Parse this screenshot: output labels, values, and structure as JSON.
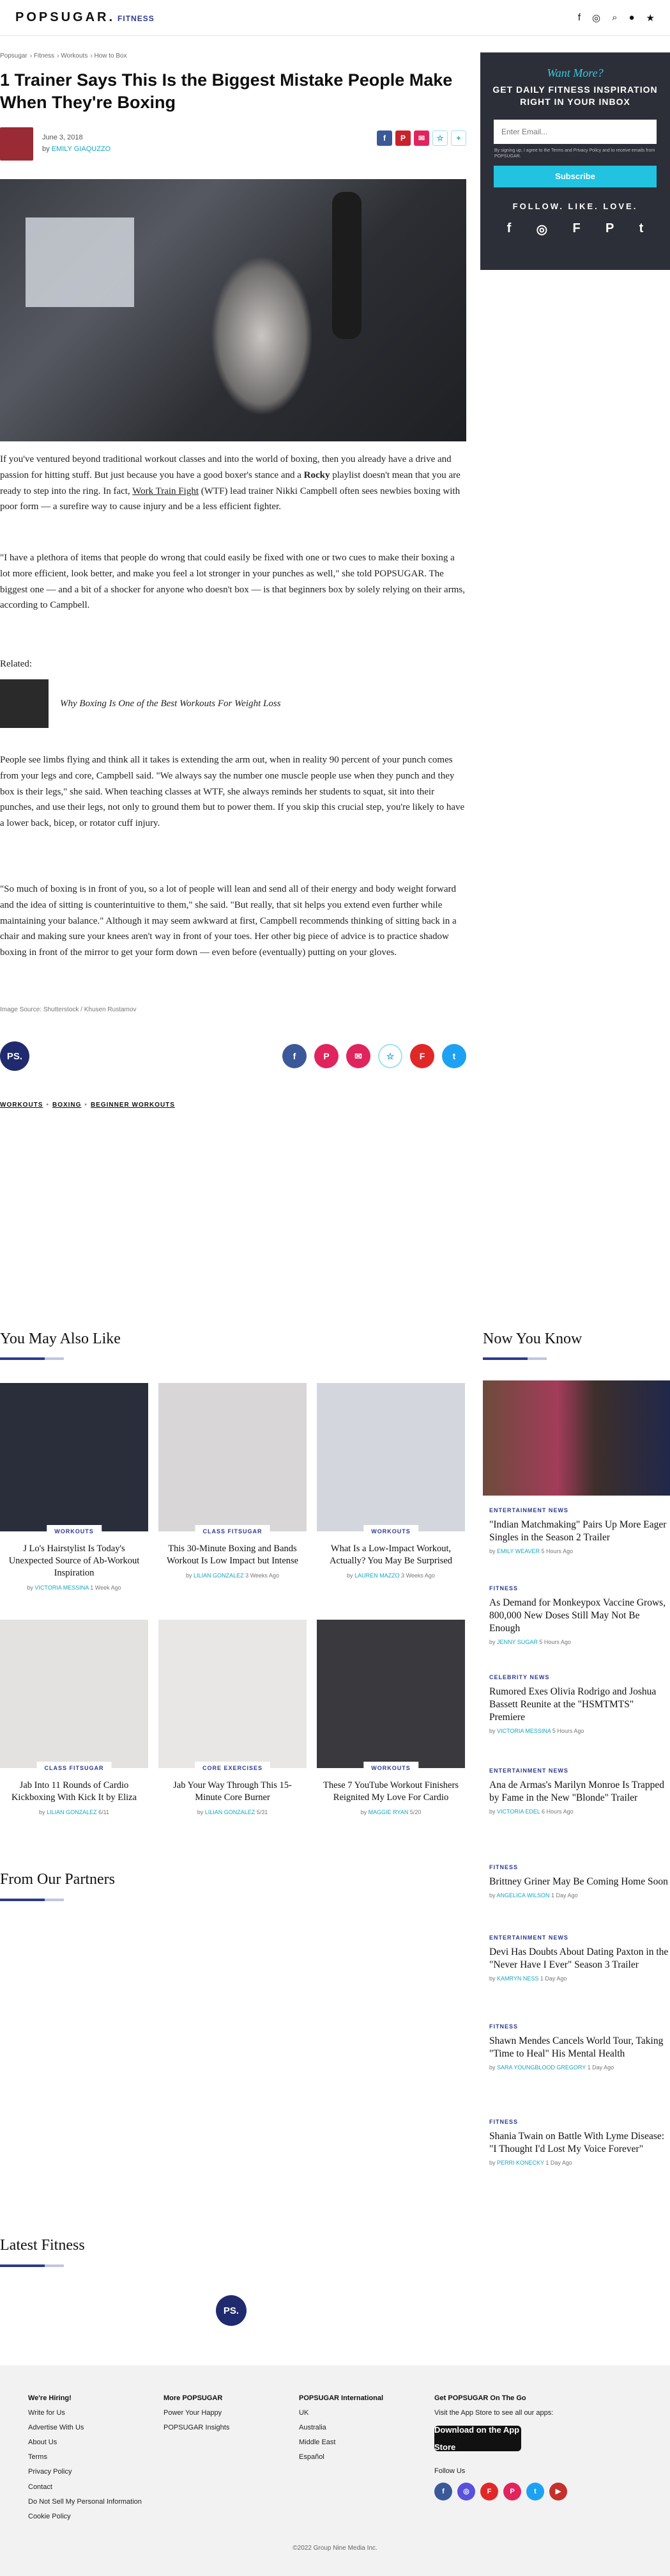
{
  "nav": {
    "logo": "POPSUGAR.",
    "section": "FITNESS",
    "icons": [
      "facebook-icon",
      "instagram-icon",
      "search-icon",
      "account-icon",
      "star-icon"
    ]
  },
  "breadcrumbs": [
    "Popsugar",
    "Fitness",
    "Workouts",
    "How to Box"
  ],
  "article": {
    "title": "1 Trainer Says This Is the Biggest Mistake People Make When They're Boxing",
    "date": "June 3, 2018",
    "by_prefix": "by",
    "author": "EMILY GIAQUZZO",
    "paragraphs": [
      {
        "before": "If you've ventured beyond traditional workout classes and into the world of boxing, then you already have a drive and passion for hitting stuff. But just because you have a good boxer's stance and a ",
        "bold": "Rocky",
        "middle": " playlist doesn't mean that you are ready to step into the ring. In fact, ",
        "link": "Work Train Fight",
        "after": " (WTF) lead trainer Nikki Campbell often sees newbies boxing with poor form — a surefire way to cause injury and be a less efficient fighter."
      },
      "\"I have a plethora of items that people do wrong that could easily be fixed with one or two cues to make their boxing a lot more efficient, look better, and make you feel a lot stronger in your punches as well,\" she told POPSUGAR. The biggest one — and a bit of a shocker for anyone who doesn't box — is that beginners box by solely relying on their arms, according to Campbell.",
      "People see limbs flying and think all it takes is extending the arm out, when in reality 90 percent of your punch comes from your legs and core, Campbell said. \"We always say the number one muscle people use when they punch and they box is their legs,\" she said. When teaching classes at WTF, she always reminds her students to squat, sit into their punches, and use their legs, not only to ground them but to power them. If you skip this crucial step, you're likely to have a lower back, bicep, or rotator cuff injury.",
      "\"So much of boxing is in front of you, so a lot of people will lean and send all of their energy and body weight forward and the idea of sitting is counterintuitive to them,\" she said. \"But really, that sit helps you extend even further while maintaining your balance.\" Although it may seem awkward at first, Campbell recommends thinking of sitting back in a chair and making sure your knees aren't way in front of your toes. Her other big piece of advice is to practice shadow boxing in front of the mirror to get your form down — even before (eventually) putting on your gloves."
    ],
    "related_label": "Related:",
    "related_title": "Why Boxing Is One of the Best Workouts For Weight Loss",
    "image_source": "Image Source: Shutterstock / Khusen Rustamov",
    "tags": [
      "WORKOUTS",
      "BOXING",
      "BEGINNER WORKOUTS"
    ],
    "ps_badge": "PS."
  },
  "share_top": [
    {
      "icon": "facebook-icon",
      "glyph": "f",
      "color": "#3b5998"
    },
    {
      "icon": "pinterest-icon",
      "glyph": "P",
      "color": "#c8232c"
    },
    {
      "icon": "email-icon",
      "glyph": "✉",
      "color": "#e0245e"
    },
    {
      "icon": "bookmark-icon",
      "glyph": "☆",
      "color": "#ffffff"
    },
    {
      "icon": "more-icon",
      "glyph": "+",
      "color": "#ffffff"
    }
  ],
  "share_bottom": [
    {
      "icon": "facebook-icon",
      "glyph": "f",
      "color": "#3b5998"
    },
    {
      "icon": "pinterest-icon",
      "glyph": "P",
      "color": "#e0245e"
    },
    {
      "icon": "email-icon",
      "glyph": "✉",
      "color": "#e0245e"
    },
    {
      "icon": "bookmark-icon",
      "glyph": "☆",
      "color": "#ffffff"
    },
    {
      "icon": "flipboard-icon",
      "glyph": "F",
      "color": "#e12828"
    },
    {
      "icon": "twitter-icon",
      "glyph": "t",
      "color": "#1da1f2"
    }
  ],
  "newsletter": {
    "want_more": "Want More?",
    "headline": "GET DAILY FITNESS INSPIRATION RIGHT IN YOUR INBOX",
    "email_placeholder": "Enter Email...",
    "fine_print": "By signing up, I agree to the Terms and Privacy Policy and to receive emails from POPSUGAR.",
    "subscribe": "Subscribe",
    "follow": "FOLLOW. LIKE. LOVE.",
    "social": [
      {
        "icon": "facebook-icon",
        "glyph": "f"
      },
      {
        "icon": "instagram-icon",
        "glyph": "◎"
      },
      {
        "icon": "flipboard-icon",
        "glyph": "F"
      },
      {
        "icon": "pinterest-icon",
        "glyph": "P"
      },
      {
        "icon": "twitter-icon",
        "glyph": "t"
      }
    ]
  },
  "you_may_also_like": {
    "title": "You May Also Like",
    "cards": [
      {
        "category": "WORKOUTS",
        "title": "J Lo's Hairstylist Is Today's Unexpected Source of Ab-Workout Inspiration",
        "author": "VICTORIA MESSINA",
        "time": "1 Week Ago",
        "tone": "#2a2d3a"
      },
      {
        "category": "CLASS FITSUGAR",
        "title": "This 30-Minute Boxing and Bands Workout Is Low Impact but Intense",
        "author": "LILIAN GONZALEZ",
        "time": "3 Weeks Ago",
        "tone": "#d9d6d8"
      },
      {
        "category": "WORKOUTS",
        "title": "What Is a Low-Impact Workout, Actually? You May Be Surprised",
        "author": "LAUREN MAZZO",
        "time": "3 Weeks Ago",
        "tone": "#d3d6dc"
      },
      {
        "category": "CLASS FITSUGAR",
        "title": "Jab Into 11 Rounds of Cardio Kickboxing With Kick It by Eliza",
        "author": "LILIAN GONZALEZ",
        "time": "6/11",
        "tone": "#e4e2e1"
      },
      {
        "category": "CORE EXERCISES",
        "title": "Jab Your Way Through This 15-Minute Core Burner",
        "author": "LILIAN GONZALEZ",
        "time": "5/31",
        "tone": "#e9e7e6"
      },
      {
        "category": "WORKOUTS",
        "title": "These 7 YouTube Workout Finishers Reignited My Love For Cardio",
        "author": "MAGGIE RYAN",
        "time": "5/20",
        "tone": "#3a3a3e"
      }
    ]
  },
  "now_you_know": {
    "title": "Now You Know",
    "items": [
      {
        "category": "ENTERTAINMENT NEWS",
        "title": "\"Indian Matchmaking\" Pairs Up More Eager Singles in the Season 2 Trailer",
        "author": "EMILY WEAVER",
        "time": "5 Hours Ago"
      },
      {
        "category": "FITNESS",
        "title": "As Demand for Monkeypox Vaccine Grows, 800,000 New Doses Still May Not Be Enough",
        "author": "JENNY SUGAR",
        "time": "5 Hours Ago"
      },
      {
        "category": "CELEBRITY NEWS",
        "title": "Rumored Exes Olivia Rodrigo and Joshua Bassett Reunite at the \"HSMTMTS\" Premiere",
        "author": "VICTORIA MESSINA",
        "time": "5 Hours Ago"
      },
      {
        "category": "ENTERTAINMENT NEWS",
        "title": "Ana de Armas's Marilyn Monroe Is Trapped by Fame in the New \"Blonde\" Trailer",
        "author": "VICTORIA EDEL",
        "time": "6 Hours Ago"
      },
      {
        "category": "FITNESS",
        "title": "Brittney Griner May Be Coming Home Soon",
        "author": "ANGELICA WILSON",
        "time": "1 Day Ago"
      },
      {
        "category": "ENTERTAINMENT NEWS",
        "title": "Devi Has Doubts About Dating Paxton in the \"Never Have I Ever\" Season 3 Trailer",
        "author": "KAMRYN NESS",
        "time": "1 Day Ago"
      },
      {
        "category": "FITNESS",
        "title": "Shawn Mendes Cancels World Tour, Taking \"Time to Heal\" His Mental Health",
        "author": "SARA YOUNGBLOOD GREGORY",
        "time": "1 Day Ago"
      },
      {
        "category": "FITNESS",
        "title": "Shania Twain on Battle With Lyme Disease: \"I Thought I'd Lost My Voice Forever\"",
        "author": "PERRI KONECKY",
        "time": "1 Day Ago"
      }
    ]
  },
  "partners": {
    "title": "From Our Partners"
  },
  "latest": {
    "title": "Latest Fitness",
    "badge": "PS."
  },
  "footer": {
    "col1": {
      "heading": "We're Hiring!",
      "links": [
        "Write for Us",
        "Advertise With Us",
        "About Us",
        "Terms",
        "Privacy Policy",
        "Contact",
        "Do Not Sell My Personal Information",
        "Cookie Policy"
      ]
    },
    "col2": {
      "heading": "More POPSUGAR",
      "links": [
        "Power Your Happy",
        "POPSUGAR Insights"
      ]
    },
    "col3": {
      "heading": "POPSUGAR International",
      "links": [
        "UK",
        "Australia",
        "Middle East",
        "Español"
      ]
    },
    "col4": {
      "heading": "Get POPSUGAR On The Go",
      "text": "Visit the App Store to see all our apps:",
      "appstore": "Download on the App Store",
      "follow": "Follow Us"
    },
    "social": [
      {
        "icon": "facebook-icon",
        "glyph": "f",
        "color": "#3b5998"
      },
      {
        "icon": "instagram-icon",
        "glyph": "◎",
        "color": "#5851db"
      },
      {
        "icon": "flipboard-icon",
        "glyph": "F",
        "color": "#e12828"
      },
      {
        "icon": "pinterest-icon",
        "glyph": "P",
        "color": "#e0245e"
      },
      {
        "icon": "twitter-icon",
        "glyph": "t",
        "color": "#1da1f2"
      },
      {
        "icon": "youtube-icon",
        "glyph": "▶",
        "color": "#c4302b"
      }
    ],
    "copyright": "©2022 Group Nine Media Inc."
  }
}
